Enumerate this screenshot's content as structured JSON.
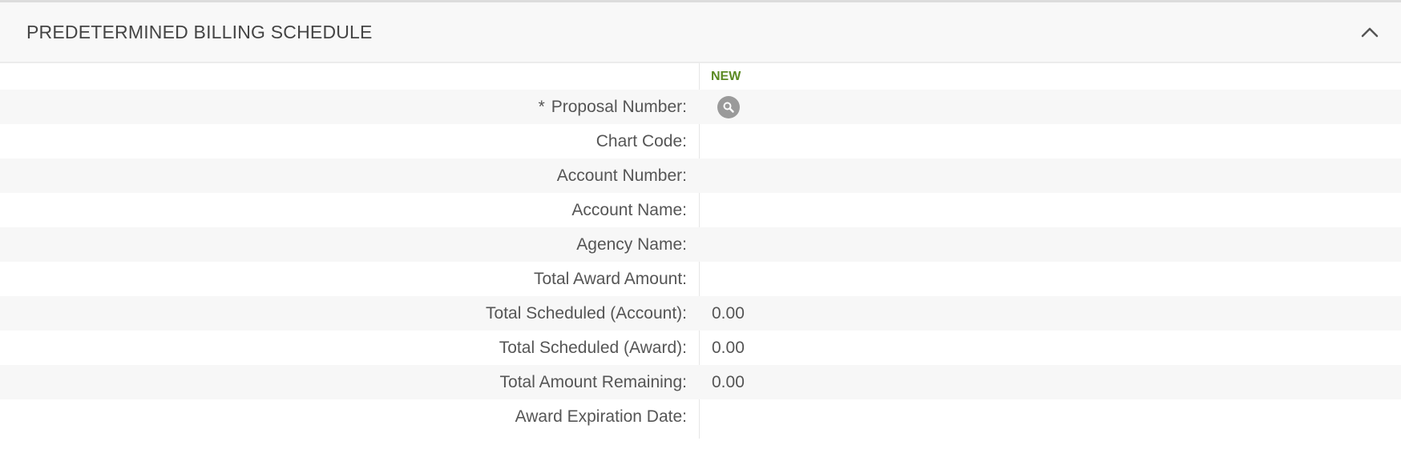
{
  "section": {
    "title": "PREDETERMINED BILLING SCHEDULE",
    "collapse_icon": "chevron-up-icon"
  },
  "form": {
    "column_header": "NEW",
    "required_marker": "*",
    "lookup_icon": "search-icon",
    "fields": [
      {
        "label": "Proposal Number:",
        "value": ""
      },
      {
        "label": "Chart Code:",
        "value": ""
      },
      {
        "label": "Account Number:",
        "value": ""
      },
      {
        "label": "Account Name:",
        "value": ""
      },
      {
        "label": "Agency Name:",
        "value": ""
      },
      {
        "label": "Total Award Amount:",
        "value": ""
      },
      {
        "label": "Total Scheduled (Account):",
        "value": "0.00"
      },
      {
        "label": "Total Scheduled (Award):",
        "value": "0.00"
      },
      {
        "label": "Total Amount Remaining:",
        "value": "0.00"
      },
      {
        "label": "Award Expiration Date:",
        "value": ""
      }
    ]
  },
  "colors": {
    "new_label": "#5b8a23",
    "row_shade": "#f7f7f7",
    "header_bg": "#f8f8f8"
  }
}
